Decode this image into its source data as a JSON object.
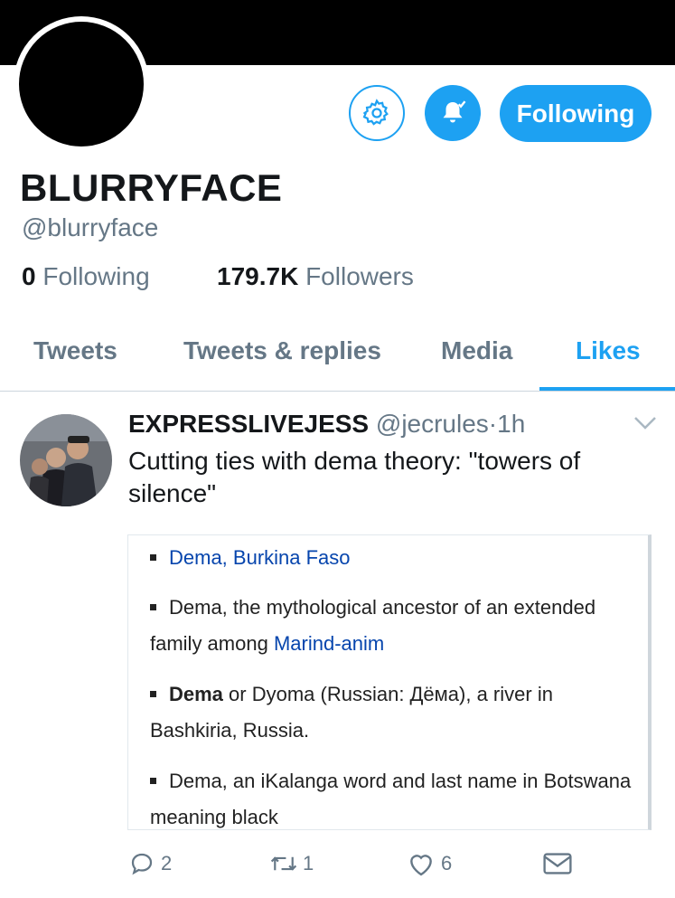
{
  "profile": {
    "display_name": "BLURRYFACE",
    "handle": "@blurryface",
    "following_count": "0",
    "following_label": "Following",
    "followers_count": "179.7K",
    "followers_label": "Followers"
  },
  "buttons": {
    "settings_icon": "gear-icon",
    "notify_icon": "bell-check-icon",
    "follow_label": "Following"
  },
  "tabs": [
    {
      "label": "Tweets"
    },
    {
      "label": "Tweets & replies"
    },
    {
      "label": "Media"
    },
    {
      "label": "Likes",
      "active": true
    }
  ],
  "tweet": {
    "author": "EXPRESSLIVEJESS",
    "handle": "@jecrules",
    "separator": "·",
    "time": "1h",
    "text": "Cutting ties with dema theory: \"towers of silence\"",
    "quote": {
      "item1_link": "Dema, Burkina Faso",
      "item2_text": "Dema, the mythological ancestor of an extended family among ",
      "item2_link": "Marind-anim",
      "item3_bold": "Dema",
      "item3_text": " or Dyoma (Russian: Дёма), a river in Bashkiria, Russia.",
      "item4_text": "Dema, an iKalanga word and last name in Botswana meaning black"
    },
    "actions": {
      "reply_count": "2",
      "retweet_count": "1",
      "like_count": "6"
    }
  },
  "colors": {
    "accent": "#1da1f2",
    "muted_text": "#657786",
    "wiki_link": "#0645ad"
  }
}
